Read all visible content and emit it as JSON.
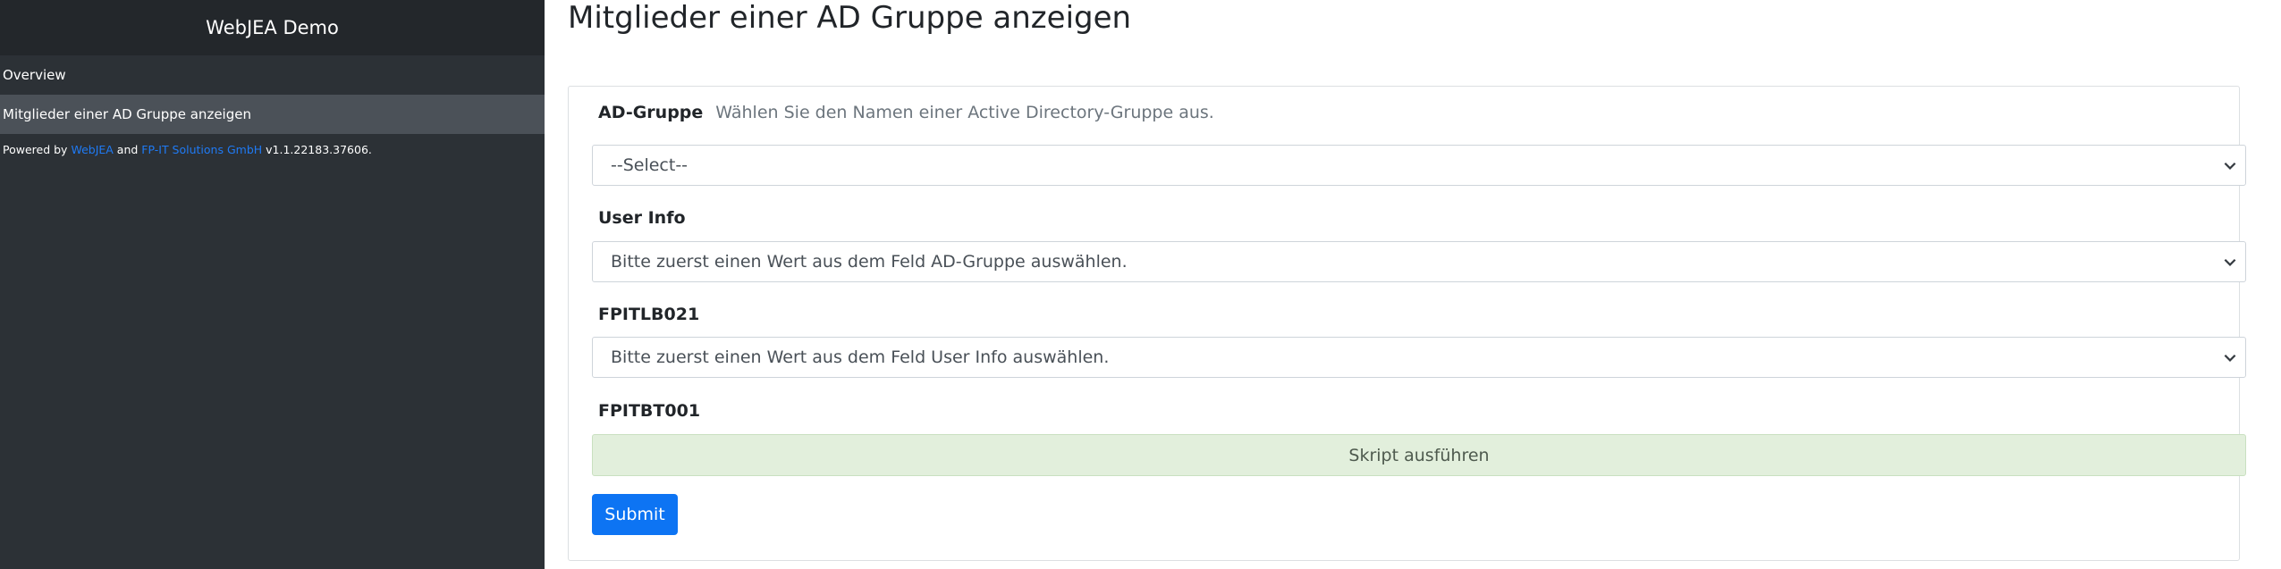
{
  "sidebar": {
    "brand": "WebJEA Demo",
    "items": [
      {
        "label": "Overview"
      },
      {
        "label": "Mitglieder einer AD Gruppe anzeigen"
      }
    ],
    "powered": {
      "prefix": "Powered by ",
      "link1": "WebJEA",
      "and": " and ",
      "link2": "FP-IT Solutions GmbH",
      "version": " v1.1.22183.37606."
    }
  },
  "main": {
    "title": "Mitglieder einer AD Gruppe anzeigen",
    "fields": [
      {
        "label": "AD-Gruppe",
        "help": "Wählen Sie den Namen einer Active Directory-Gruppe aus.",
        "value": "--Select--"
      },
      {
        "label": "User Info",
        "value": "Bitte zuerst einen Wert aus dem Feld AD-Gruppe auswählen."
      },
      {
        "label": "FPITLB021",
        "value": "Bitte zuerst einen Wert aus dem Feld User Info auswählen."
      },
      {
        "label": "FPITBT001",
        "value": "Skript ausführen"
      }
    ],
    "submit_label": "Submit"
  },
  "colors": {
    "sidebar_bg": "#2c3136",
    "brand_bg": "#23272b",
    "active_item_bg": "#4b5158",
    "link": "#1f7af4",
    "submit": "#0d74f3",
    "run_box_bg": "#e2efdc"
  },
  "icons": [
    "chevron-down-icon"
  ]
}
